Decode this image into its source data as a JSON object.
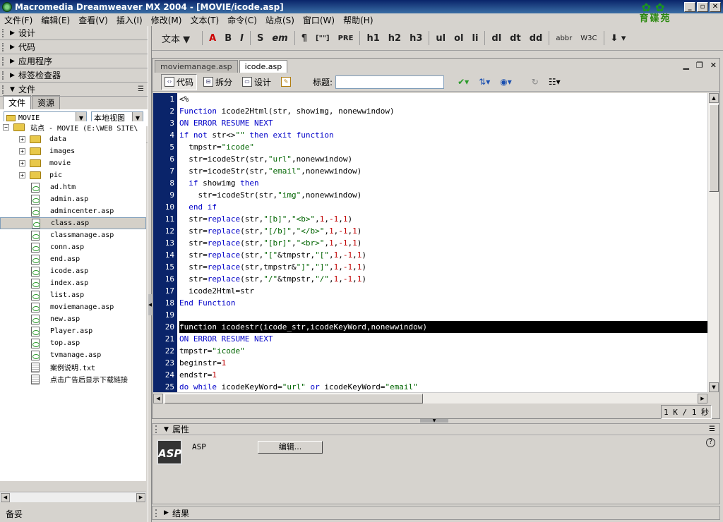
{
  "window": {
    "title": "Macromedia Dreamweaver MX 2004 - [MOVIE/icode.asp]",
    "logo_text": "育碟苑",
    "controls": [
      "_",
      "▫",
      "✕"
    ]
  },
  "menu": [
    "文件(F)",
    "编辑(E)",
    "查看(V)",
    "插入(I)",
    "修改(M)",
    "文本(T)",
    "命令(C)",
    "站点(S)",
    "窗口(W)",
    "帮助(H)"
  ],
  "left_panels": {
    "groups": [
      "设计",
      "代码",
      "应用程序",
      "标签检查器",
      "文件"
    ],
    "file_tabs": {
      "active": "文件",
      "inactive": "资源"
    },
    "site_select": "MOVIE",
    "view_select": "本地视图",
    "site_root": "站点 - MOVIE (E:\\WEB SITE\\",
    "items": [
      {
        "name": "data",
        "type": "folder"
      },
      {
        "name": "images",
        "type": "folder"
      },
      {
        "name": "movie",
        "type": "folder"
      },
      {
        "name": "pic",
        "type": "folder"
      },
      {
        "name": "ad.htm",
        "type": "file"
      },
      {
        "name": "admin.asp",
        "type": "file"
      },
      {
        "name": "admincenter.asp",
        "type": "file"
      },
      {
        "name": "class.asp",
        "type": "file"
      },
      {
        "name": "classmanage.asp",
        "type": "file"
      },
      {
        "name": "conn.asp",
        "type": "file"
      },
      {
        "name": "end.asp",
        "type": "file"
      },
      {
        "name": "icode.asp",
        "type": "file"
      },
      {
        "name": "index.asp",
        "type": "file"
      },
      {
        "name": "list.asp",
        "type": "file"
      },
      {
        "name": "moviemanage.asp",
        "type": "file"
      },
      {
        "name": "new.asp",
        "type": "file"
      },
      {
        "name": "Player.asp",
        "type": "file"
      },
      {
        "name": "top.asp",
        "type": "file"
      },
      {
        "name": "tvmanage.asp",
        "type": "file"
      },
      {
        "name": "案例说明.txt",
        "type": "text"
      },
      {
        "name": "点击广告后显示下载链接",
        "type": "text"
      }
    ],
    "status": "备妥"
  },
  "insert_bar": {
    "category": "文本 ▼",
    "buttons": [
      "A",
      "B",
      "I",
      "S",
      "em",
      "¶",
      "[\"\"]",
      "PRE",
      "h1",
      "h2",
      "h3",
      "ul",
      "ol",
      "li",
      "dl",
      "dt",
      "dd",
      "abbr",
      "W3C",
      "⬇ ▾"
    ]
  },
  "document": {
    "tabs": {
      "inactive": "moviemanage.asp",
      "active": "icode.asp"
    },
    "view_buttons": [
      "代码",
      "拆分",
      "设计"
    ],
    "title_label": "标题:",
    "title_value": "",
    "size_status": "1 K / 1 秒",
    "code_lines": [
      "<%",
      "Function icode2Html(str, showimg, nonewwindow)",
      "ON ERROR RESUME NEXT",
      "if not str<>\"\" then exit function",
      "  tmpstr=\"icode\"",
      "  str=icodeStr(str,\"url\",nonewwindow)",
      "  str=icodeStr(str,\"email\",nonewwindow)",
      "  if showimg then",
      "    str=icodeStr(str,\"img\",nonewwindow)",
      "  end if",
      "  str=replace(str,\"[b]\",\"<b>\",1,-1,1)",
      "  str=replace(str,\"[/b]\",\"</b>\",1,-1,1)",
      "  str=replace(str,\"[br]\",\"<br>\",1,-1,1)",
      "  str=replace(str,\"[\"&tmpstr,\"[\",1,-1,1)",
      "  str=replace(str,tmpstr&\"]\",\"]\",1,-1,1)",
      "  str=replace(str,\"/\"&tmpstr,\"/\",1,-1,1)",
      "  icode2Html=str",
      "End Function",
      "",
      "function icodestr(icode_str,icodeKeyWord,nonewwindow)",
      "ON ERROR RESUME NEXT",
      "tmpstr=\"icode\"",
      "beginstr=1",
      "endstr=1",
      "do while icodeKeyWord=\"url\" or icodeKeyWord=\"email\""
    ],
    "highlighted_line": 20
  },
  "properties": {
    "header": "属性",
    "icon_text": "ASP",
    "type_label": "ASP",
    "edit_button": "编辑...",
    "help": "?"
  },
  "results": {
    "header": "结果"
  },
  "colors": {
    "gutter": "#0a246a",
    "keyword": "#0000c8",
    "string": "#006400",
    "number": "#c00000",
    "titlebar": "#0a246a"
  }
}
